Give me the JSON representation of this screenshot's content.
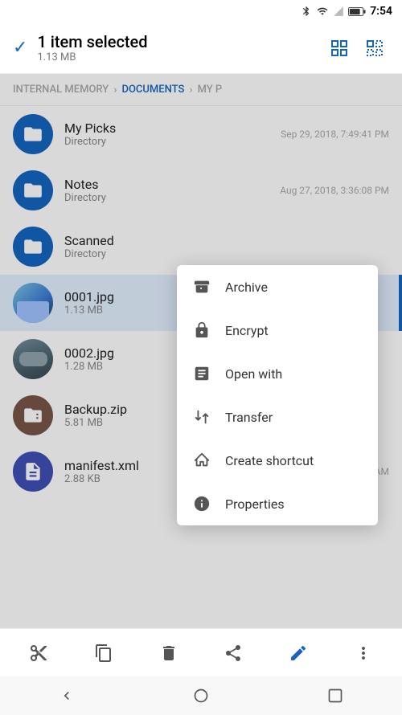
{
  "statusBar": {
    "time": "7:54"
  },
  "header": {
    "selectedLabel": "1 item selected",
    "sizeLabel": "1.13 MB"
  },
  "breadcrumb": {
    "items": [
      {
        "label": "INTERNAL MEMORY",
        "active": false
      },
      {
        "label": "DOCUMENTS",
        "active": true
      },
      {
        "label": "MY P",
        "active": false
      }
    ]
  },
  "fileList": [
    {
      "name": "My Picks",
      "sub": "Directory",
      "date": "Sep 29, 2018, 7:49:41 PM",
      "type": "folder",
      "selected": false
    },
    {
      "name": "Notes",
      "sub": "Directory",
      "date": "Aug 27, 2018, 3:36:08 PM",
      "type": "folder",
      "selected": false
    },
    {
      "name": "Scanned",
      "sub": "Directory",
      "date": "",
      "type": "folder",
      "selected": false
    },
    {
      "name": "0001.jpg",
      "sub": "1.13 MB",
      "date": "",
      "type": "image-blue",
      "selected": true
    },
    {
      "name": "0002.jpg",
      "sub": "1.28 MB",
      "date": "",
      "type": "image-car",
      "selected": false
    },
    {
      "name": "Backup.zip",
      "sub": "5.81 MB",
      "date": "",
      "type": "zip",
      "selected": false
    },
    {
      "name": "manifest.xml",
      "sub": "2.88 KB",
      "date": "Jan 01, 2009, 9:00:00 AM",
      "type": "xml",
      "selected": false
    }
  ],
  "contextMenu": {
    "items": [
      {
        "id": "archive",
        "label": "Archive",
        "icon": "archive"
      },
      {
        "id": "encrypt",
        "label": "Encrypt",
        "icon": "lock"
      },
      {
        "id": "open-with",
        "label": "Open with",
        "icon": "open-external"
      },
      {
        "id": "transfer",
        "label": "Transfer",
        "icon": "transfer"
      },
      {
        "id": "create-shortcut",
        "label": "Create shortcut",
        "icon": "shortcut"
      },
      {
        "id": "properties",
        "label": "Properties",
        "icon": "info"
      }
    ]
  },
  "bottomBar": {
    "buttons": [
      {
        "id": "cut",
        "icon": "scissors"
      },
      {
        "id": "copy",
        "icon": "copy"
      },
      {
        "id": "delete",
        "icon": "trash"
      },
      {
        "id": "share",
        "icon": "share"
      },
      {
        "id": "rename",
        "icon": "edit"
      },
      {
        "id": "more",
        "icon": "more-vertical"
      }
    ]
  },
  "navBar": {
    "back": "◁",
    "home": "○",
    "square": "□"
  }
}
